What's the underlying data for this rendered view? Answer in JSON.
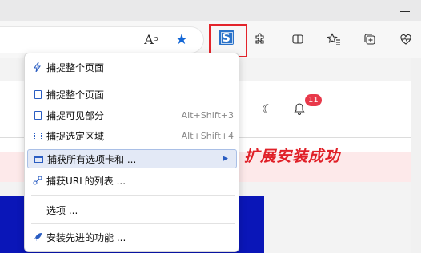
{
  "toolbar": {
    "read_aloud_label": "A",
    "read_aloud_sup": "ↄ",
    "favorite_icon": "star-icon",
    "extension_letter": "S"
  },
  "page": {
    "notification_count": "11",
    "success_text": "扩展安装成功"
  },
  "menu": {
    "items": [
      {
        "label": "捕捉整个页面",
        "icon": "lightning-icon",
        "shortcut": ""
      },
      {
        "label": "捕捉整个页面",
        "icon": "page-icon",
        "shortcut": ""
      },
      {
        "label": "捕捉可见部分",
        "icon": "visible-page-icon",
        "shortcut": "Alt+Shift+3"
      },
      {
        "label": "捕捉选定区域",
        "icon": "selection-icon",
        "shortcut": "Alt+Shift+4"
      },
      {
        "label": "捕获所有选项卡和 ...",
        "icon": "window-icon",
        "shortcut": ""
      },
      {
        "label": "捕获URL的列表 ...",
        "icon": "link-icon",
        "shortcut": ""
      },
      {
        "label": "选项 ...",
        "icon": "",
        "shortcut": ""
      },
      {
        "label": "安装先进的功能 ...",
        "icon": "rocket-icon",
        "shortcut": ""
      }
    ]
  },
  "colors": {
    "accent": "#2a5dc2",
    "highlight_border": "#e3242b",
    "success_text": "#e02028",
    "banner": "#0a16b8"
  }
}
